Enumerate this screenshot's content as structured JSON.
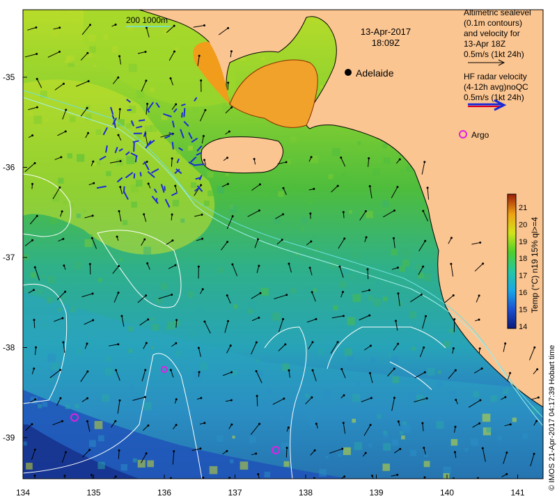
{
  "map": {
    "date": "13-Apr-2017",
    "time": "18:09Z",
    "city": "Adelaide",
    "argo_label": "Argo",
    "bathy_legend": "200 1000m",
    "sealevel_legend": [
      "Altimetric sealevel",
      "(0.1m contours)",
      "and velocity for",
      "13-Apr 18Z",
      "0.5m/s (1kt 24h)"
    ],
    "radar_legend": [
      "HF radar velocity",
      "(4-12h avg)noQC",
      "0.5m/s (1kt 24h)"
    ],
    "colorbar_title": "Temp (°C) n19 15% ql>=4",
    "colorbar_ticks": [
      "21",
      "20",
      "19",
      "18",
      "17",
      "16",
      "15",
      "14"
    ],
    "credit": "© IMOS 21-Apr-2017 04:17:39 Hobart time",
    "x_ticks": [
      "134",
      "135",
      "136",
      "137",
      "138",
      "139",
      "140",
      "141"
    ],
    "y_ticks": [
      "-35",
      "-36",
      "-37",
      "-38",
      "-39"
    ],
    "colors": {
      "land": "#fbc591",
      "sea_warm": "#66cc33",
      "sea_cool": "#2db3b0",
      "sea_cold": "#2244aa",
      "coast": "#000000",
      "radar": "#1a2bd6",
      "argo": "#e020e0",
      "contour": "#ffffff"
    }
  }
}
